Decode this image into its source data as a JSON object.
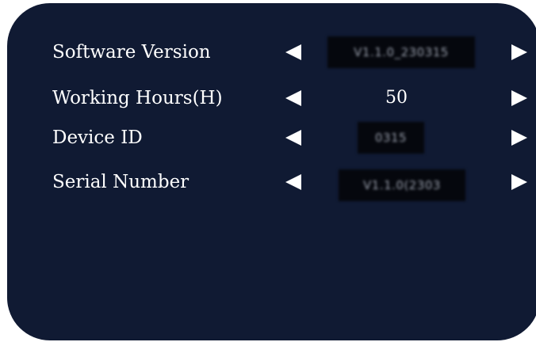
{
  "colors": {
    "panel_background": "#101a33",
    "text": "#ffffff",
    "redaction_box": "#05070d"
  },
  "icons": {
    "decrease": "left-triangle-icon",
    "increase": "right-triangle-icon"
  },
  "rows": [
    {
      "label": "Software Version",
      "value": "V1.1.0_230315",
      "redacted": true
    },
    {
      "label": "Working Hours(H)",
      "value": "50",
      "redacted": false
    },
    {
      "label": "Device ID",
      "value": "0315",
      "redacted": true
    },
    {
      "label": "Serial Number",
      "value": "V1.1.0(2303",
      "redacted": true
    }
  ]
}
